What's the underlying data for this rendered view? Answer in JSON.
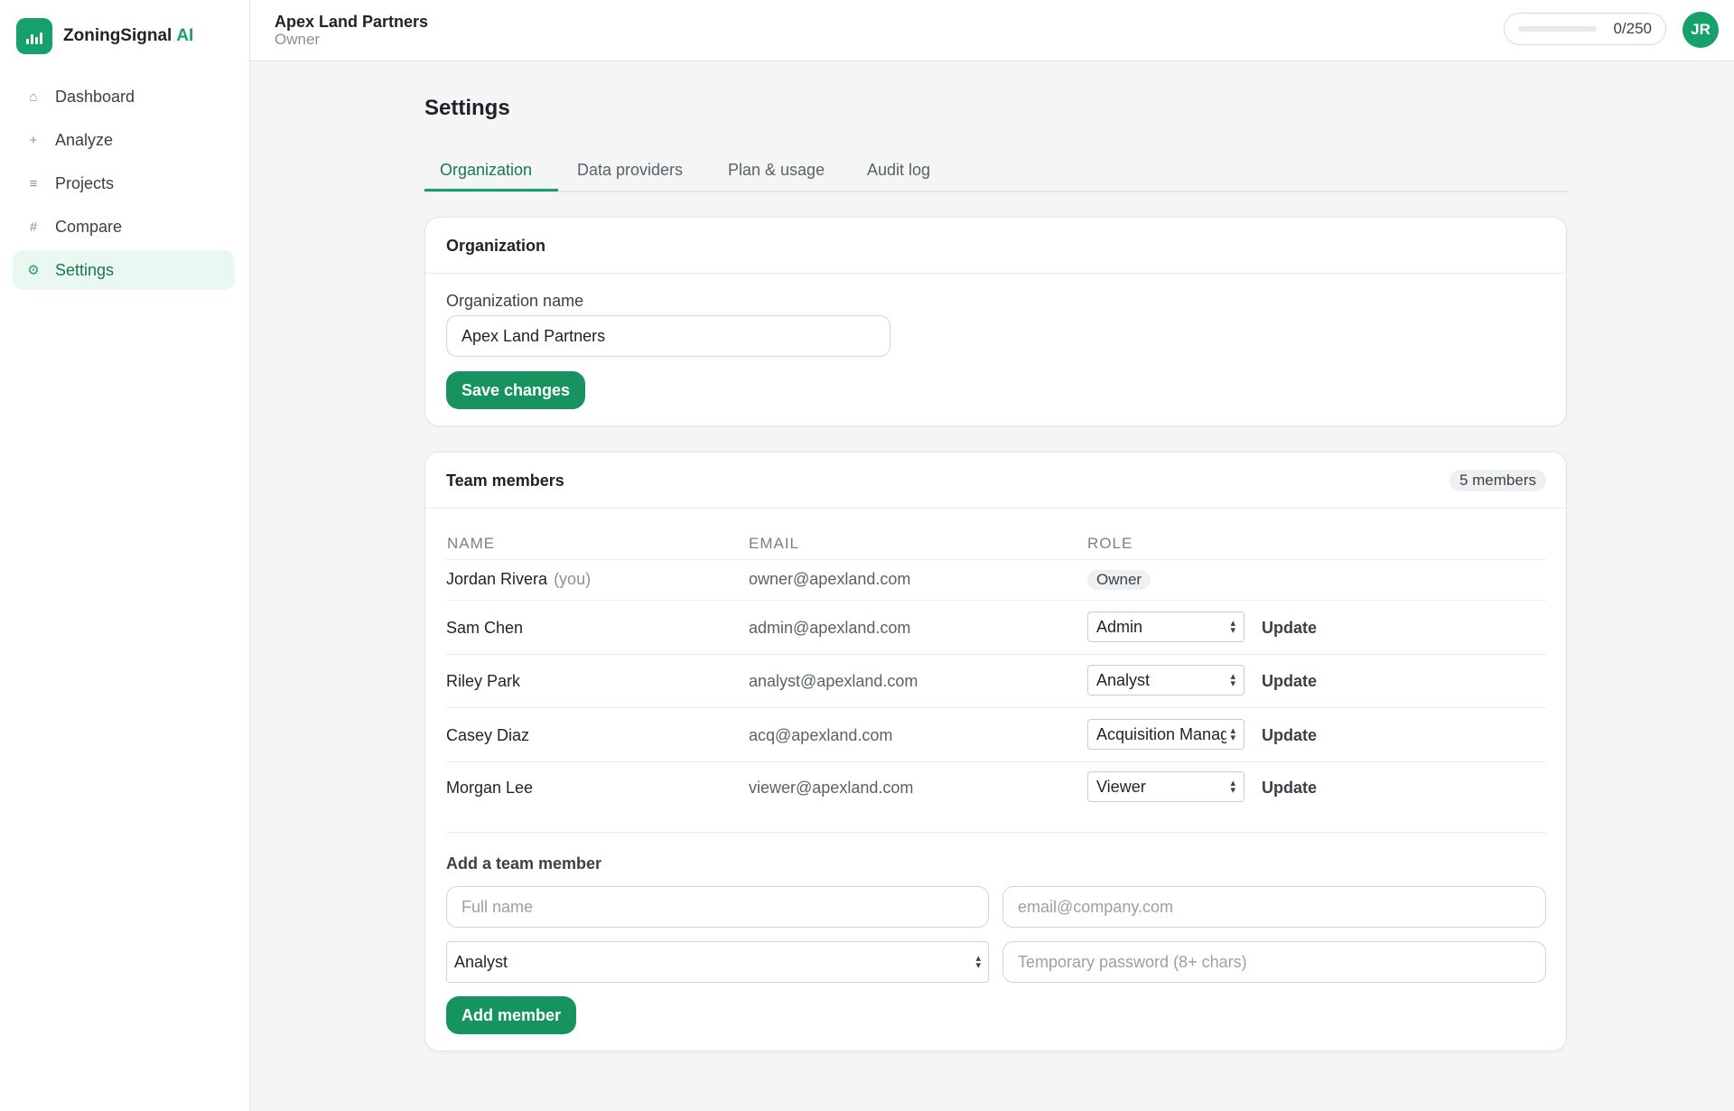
{
  "app": {
    "brand_name": "ZoningSignal",
    "brand_suffix": "AI",
    "accent_color": "#16a06b"
  },
  "sidebar": {
    "items": [
      {
        "label": "Dashboard",
        "icon": "home-icon",
        "glyph": "⌂"
      },
      {
        "label": "Analyze",
        "icon": "plus-icon",
        "glyph": "+"
      },
      {
        "label": "Projects",
        "icon": "list-icon",
        "glyph": "≡"
      },
      {
        "label": "Compare",
        "icon": "grid-icon",
        "glyph": "#"
      },
      {
        "label": "Settings",
        "icon": "gear-icon",
        "glyph": "⚙",
        "active": true
      }
    ]
  },
  "header": {
    "org_name": "Apex Land Partners",
    "org_role": "Owner",
    "usage_text": "0/250",
    "usage_fraction": 0,
    "avatar_initials": "JR"
  },
  "page": {
    "title": "Settings",
    "tabs": [
      {
        "label": "Organization",
        "active": true
      },
      {
        "label": "Data providers"
      },
      {
        "label": "Plan & usage"
      },
      {
        "label": "Audit log"
      }
    ]
  },
  "organization": {
    "card_title": "Organization",
    "name_label": "Organization name",
    "name_value": "Apex Land Partners",
    "save_label": "Save changes"
  },
  "team": {
    "card_title": "Team members",
    "count_label": "5 members",
    "columns": {
      "name": "NAME",
      "email": "EMAIL",
      "role": "ROLE"
    },
    "update_label": "Update",
    "members": [
      {
        "name": "Jordan Rivera",
        "you_label": "(you)",
        "email": "owner@apexland.com",
        "role": "Owner",
        "editable": false
      },
      {
        "name": "Sam Chen",
        "email": "admin@apexland.com",
        "role": "Admin",
        "editable": true
      },
      {
        "name": "Riley Park",
        "email": "analyst@apexland.com",
        "role": "Analyst",
        "editable": true
      },
      {
        "name": "Casey Diaz",
        "email": "acq@apexland.com",
        "role": "Acquisition Manager",
        "editable": true
      },
      {
        "name": "Morgan Lee",
        "email": "viewer@apexland.com",
        "role": "Viewer",
        "editable": true
      }
    ],
    "add_form": {
      "title": "Add a team member",
      "full_name_placeholder": "Full name",
      "email_placeholder": "email@company.com",
      "role_value": "Analyst",
      "password_placeholder": "Temporary password (8+ chars)",
      "submit_label": "Add member"
    }
  }
}
